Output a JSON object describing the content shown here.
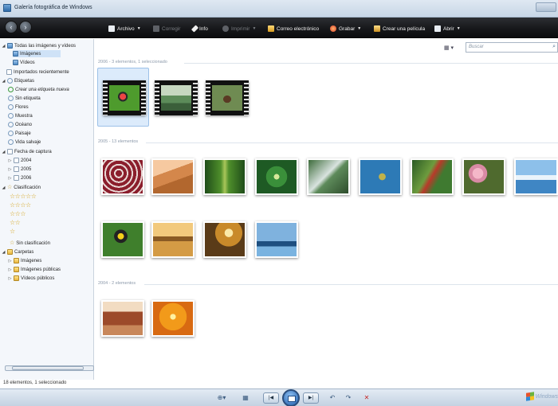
{
  "window": {
    "title": "Galería fotográfica de Windows"
  },
  "toolbar": {
    "archivo": "Archivo",
    "corregir": "Corregir",
    "info": "Info",
    "imprimir": "Imprimir",
    "correo": "Correo electrónico",
    "grabar": "Grabar",
    "pelicula": "Crear una película",
    "abrir": "Abrir"
  },
  "sidebar": {
    "all": "Todas las imágenes y vídeos",
    "imagenes": "Imágenes",
    "videos": "Vídeos",
    "recientes": "Importados recientemente",
    "etiquetas": "Etiquetas",
    "crear_etiqueta": "Crear una etiqueta nueva",
    "sin_etiqueta": "Sin etiqueta",
    "flores": "Flores",
    "muestra": "Muestra",
    "oceano": "Océano",
    "paisaje": "Paisaje",
    "vida_salvaje": "Vida salvaje",
    "fecha": "Fecha de captura",
    "y2004": "2004",
    "y2005": "2005",
    "y2006": "2006",
    "clasificacion": "Clasificación",
    "stars5": "☆☆☆☆☆",
    "stars4": "☆☆☆☆",
    "stars3": "☆☆☆",
    "stars2": "☆☆",
    "stars1": "☆",
    "sin_clasificacion": "Sin clasificación",
    "carpetas": "Carpetas",
    "c_imagenes": "Imágenes",
    "c_imagenes_publicas": "Imágenes públicas",
    "c_videos_publicos": "Vídeos públicos"
  },
  "status": {
    "text": "18 elementos, 1 seleccionado"
  },
  "search": {
    "placeholder": "Buscar"
  },
  "groups": {
    "g2006": "2006 - 3 elementos, 1 seleccionado",
    "g2005": "2005 - 13 elementos",
    "g2004": "2004 - 2 elementos"
  },
  "logo": {
    "text": "Windows"
  },
  "colors": {
    "toolbar_bg": "#17181b",
    "selection": "#dcebfb",
    "accent": "#1d5aa8"
  }
}
